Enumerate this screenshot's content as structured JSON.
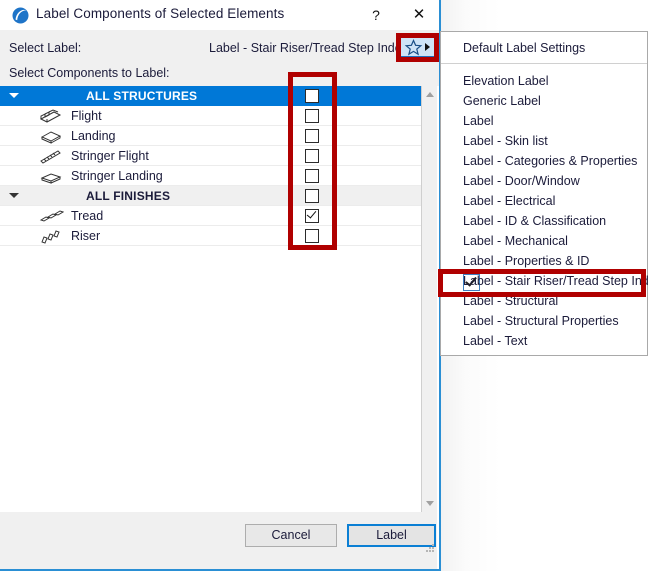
{
  "dialog": {
    "title": "Label Components of Selected Elements",
    "app_icon": "archicad-icon",
    "help_label": "?",
    "close_label": "✕",
    "select_label_caption": "Select Label:",
    "select_label_value": "Label - Stair Riser/Tread Step Index",
    "favorites_icon": "star-icon",
    "select_components_caption": "Select Components to Label:",
    "buttons": {
      "cancel": "Cancel",
      "primary": "Label"
    }
  },
  "components": [
    {
      "label": "ALL STRUCTURES",
      "type": "group",
      "selected": true,
      "checked": false,
      "icon": "none"
    },
    {
      "label": "Flight",
      "type": "item",
      "selected": false,
      "checked": false,
      "icon": "flight-icon"
    },
    {
      "label": "Landing",
      "type": "item",
      "selected": false,
      "checked": false,
      "icon": "landing-icon"
    },
    {
      "label": "Stringer Flight",
      "type": "item",
      "selected": false,
      "checked": false,
      "icon": "stringer-flight-icon"
    },
    {
      "label": "Stringer Landing",
      "type": "item",
      "selected": false,
      "checked": false,
      "icon": "stringer-landing-icon"
    },
    {
      "label": "ALL FINISHES",
      "type": "group",
      "selected": false,
      "checked": false,
      "icon": "none"
    },
    {
      "label": "Tread",
      "type": "item",
      "selected": false,
      "checked": true,
      "icon": "tread-icon"
    },
    {
      "label": "Riser",
      "type": "item",
      "selected": false,
      "checked": false,
      "icon": "riser-icon"
    }
  ],
  "dropdown": {
    "header": "Default Label Settings",
    "items": [
      {
        "label": "Elevation Label",
        "checked": false
      },
      {
        "label": "Generic Label",
        "checked": false
      },
      {
        "label": "Label",
        "checked": false
      },
      {
        "label": "Label -  Skin list",
        "checked": false
      },
      {
        "label": "Label - Categories & Properties",
        "checked": false
      },
      {
        "label": "Label - Door/Window",
        "checked": false
      },
      {
        "label": "Label - Electrical",
        "checked": false
      },
      {
        "label": "Label - ID & Classification",
        "checked": false
      },
      {
        "label": "Label - Mechanical",
        "checked": false
      },
      {
        "label": "Label - Properties & ID",
        "checked": false
      },
      {
        "label": "Label - Stair Riser/Tread Step Index",
        "checked": true
      },
      {
        "label": "Label - Structural",
        "checked": false
      },
      {
        "label": "Label - Structural Properties",
        "checked": false
      },
      {
        "label": "Label - Text",
        "checked": false
      }
    ]
  },
  "colors": {
    "selection_blue": "#0078d7",
    "annotation_red": "#b00000",
    "dialog_border_blue": "#2a8fd4",
    "primary_button_blue": "#0b7fd4"
  }
}
